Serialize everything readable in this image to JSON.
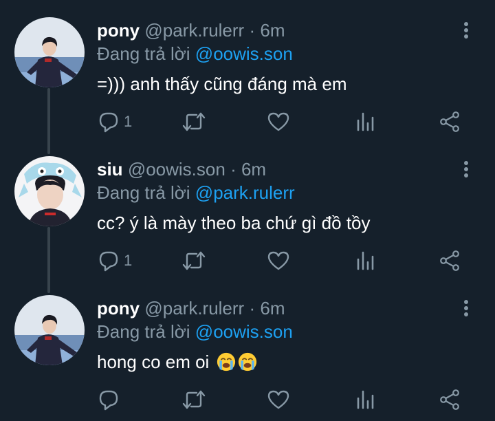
{
  "thread": [
    {
      "display_name": "pony",
      "handle": "@park.rulerr",
      "separator": "·",
      "time": "6m",
      "reply_prefix": "Đang trả lời",
      "reply_to": "@oowis.son",
      "text": "=))) anh thấy cũng đáng mà em",
      "emoji_suffix": "",
      "reply_count": "1",
      "avatar": "pony-avatar"
    },
    {
      "display_name": "siu",
      "handle": "@oowis.son",
      "separator": "·",
      "time": "6m",
      "reply_prefix": "Đang trả lời",
      "reply_to": "@park.rulerr",
      "text": "cc? ý là mày theo ba chứ gì đồ tồy",
      "emoji_suffix": "",
      "reply_count": "1",
      "avatar": "siu-avatar"
    },
    {
      "display_name": "pony",
      "handle": "@park.rulerr",
      "separator": "·",
      "time": "6m",
      "reply_prefix": "Đang trả lời",
      "reply_to": "@oowis.son",
      "text": "hong co em oi ",
      "emoji_suffix": "loudly-crying-face x2",
      "reply_count": "",
      "avatar": "pony-avatar"
    }
  ],
  "icons": {
    "reply": "reply-icon",
    "retweet": "retweet-icon",
    "like": "heart-icon",
    "analytics": "analytics-icon",
    "share": "share-icon",
    "more": "more-vertical-icon"
  },
  "colors": {
    "background": "#15202b",
    "text": "#ffffff",
    "secondary": "#8899a6",
    "link": "#1da1f2",
    "thread_line": "#38444d"
  }
}
